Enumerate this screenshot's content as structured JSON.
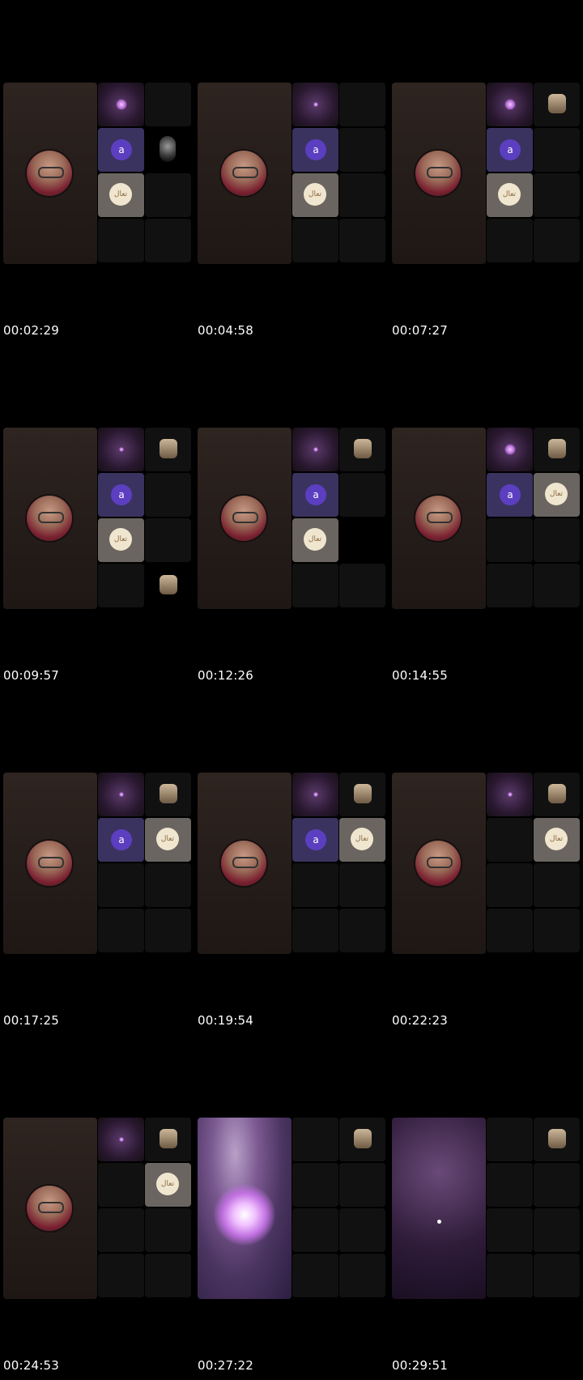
{
  "timestamps": [
    "00:02:29",
    "00:04:58",
    "00:07:27",
    "00:09:57",
    "00:12:26",
    "00:14:55",
    "00:17:25",
    "00:19:54",
    "00:22:23",
    "00:24:53",
    "00:27:22",
    "00:29:51"
  ],
  "icons": {
    "a_label": "a",
    "cal_label": "ﺗﻌﺎﻝ"
  },
  "colors": {
    "background": "#000000",
    "tile_dark": "#111111",
    "tile_purple": "#3a3360",
    "tile_cream": "#6a6560",
    "avatar_accent": "#5b3fc0"
  }
}
